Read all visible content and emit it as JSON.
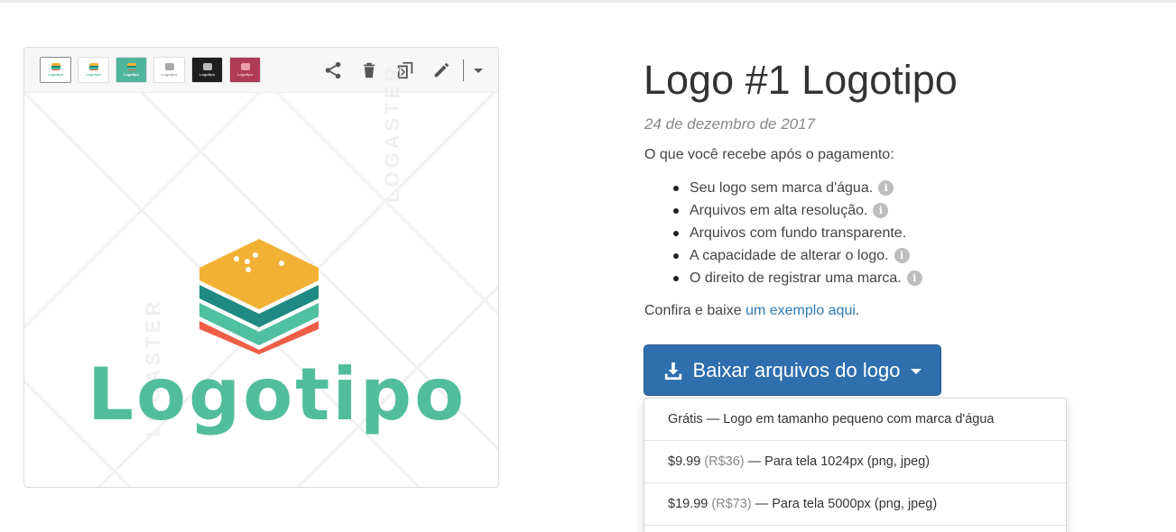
{
  "colors": {
    "accent_button": "#2f6fad",
    "link": "#2e7bb5",
    "logo_teal": "#52bd9c",
    "logo_yellow": "#f2b134",
    "logo_dark_teal": "#1e8a83",
    "logo_red": "#ee5d45"
  },
  "preview": {
    "thumbnails": [
      {
        "label": "Logotipo"
      },
      {
        "label": "Logotipo"
      },
      {
        "label": "Logotipo"
      },
      {
        "label": "Logotipo"
      },
      {
        "label": "Logotipo"
      },
      {
        "label": "Logotipo"
      }
    ],
    "tools": [
      "share-icon",
      "trash-icon",
      "copy-icon",
      "pencil-icon",
      "chevron-down-icon"
    ],
    "watermark": "LOGASTER",
    "logo_text": "Logotipo"
  },
  "product": {
    "title": "Logo #1 Logotipo",
    "date": "24 de dezembro de 2017",
    "intro": "O que você recebe após o pagamento:",
    "features": [
      {
        "text": "Seu logo sem marca d'água.",
        "info": true
      },
      {
        "text": "Arquivos em alta resolução.",
        "info": true
      },
      {
        "text": "Arquivos com fundo transparente.",
        "info": false
      },
      {
        "text": "A capacidade de alterar o logo.",
        "info": true
      },
      {
        "text": "O direito de registrar uma marca.",
        "info": true
      }
    ],
    "info_glyph": "i",
    "example_prefix": "Confira e baixe ",
    "example_link": "um exemplo aqui",
    "example_suffix": "."
  },
  "download": {
    "button_label": "Baixar arquivos do logo",
    "menu": [
      {
        "price": "",
        "local": "",
        "text": "Grátis — Logo em tamanho pequeno com marca d'água"
      },
      {
        "price": "$9.99",
        "local": "(R$36)",
        "text": "— Para tela 1024px (png, jpeg)"
      },
      {
        "price": "$19.99",
        "local": "(R$73)",
        "text": "— Para tela 5000px (png, jpeg)"
      }
    ]
  }
}
